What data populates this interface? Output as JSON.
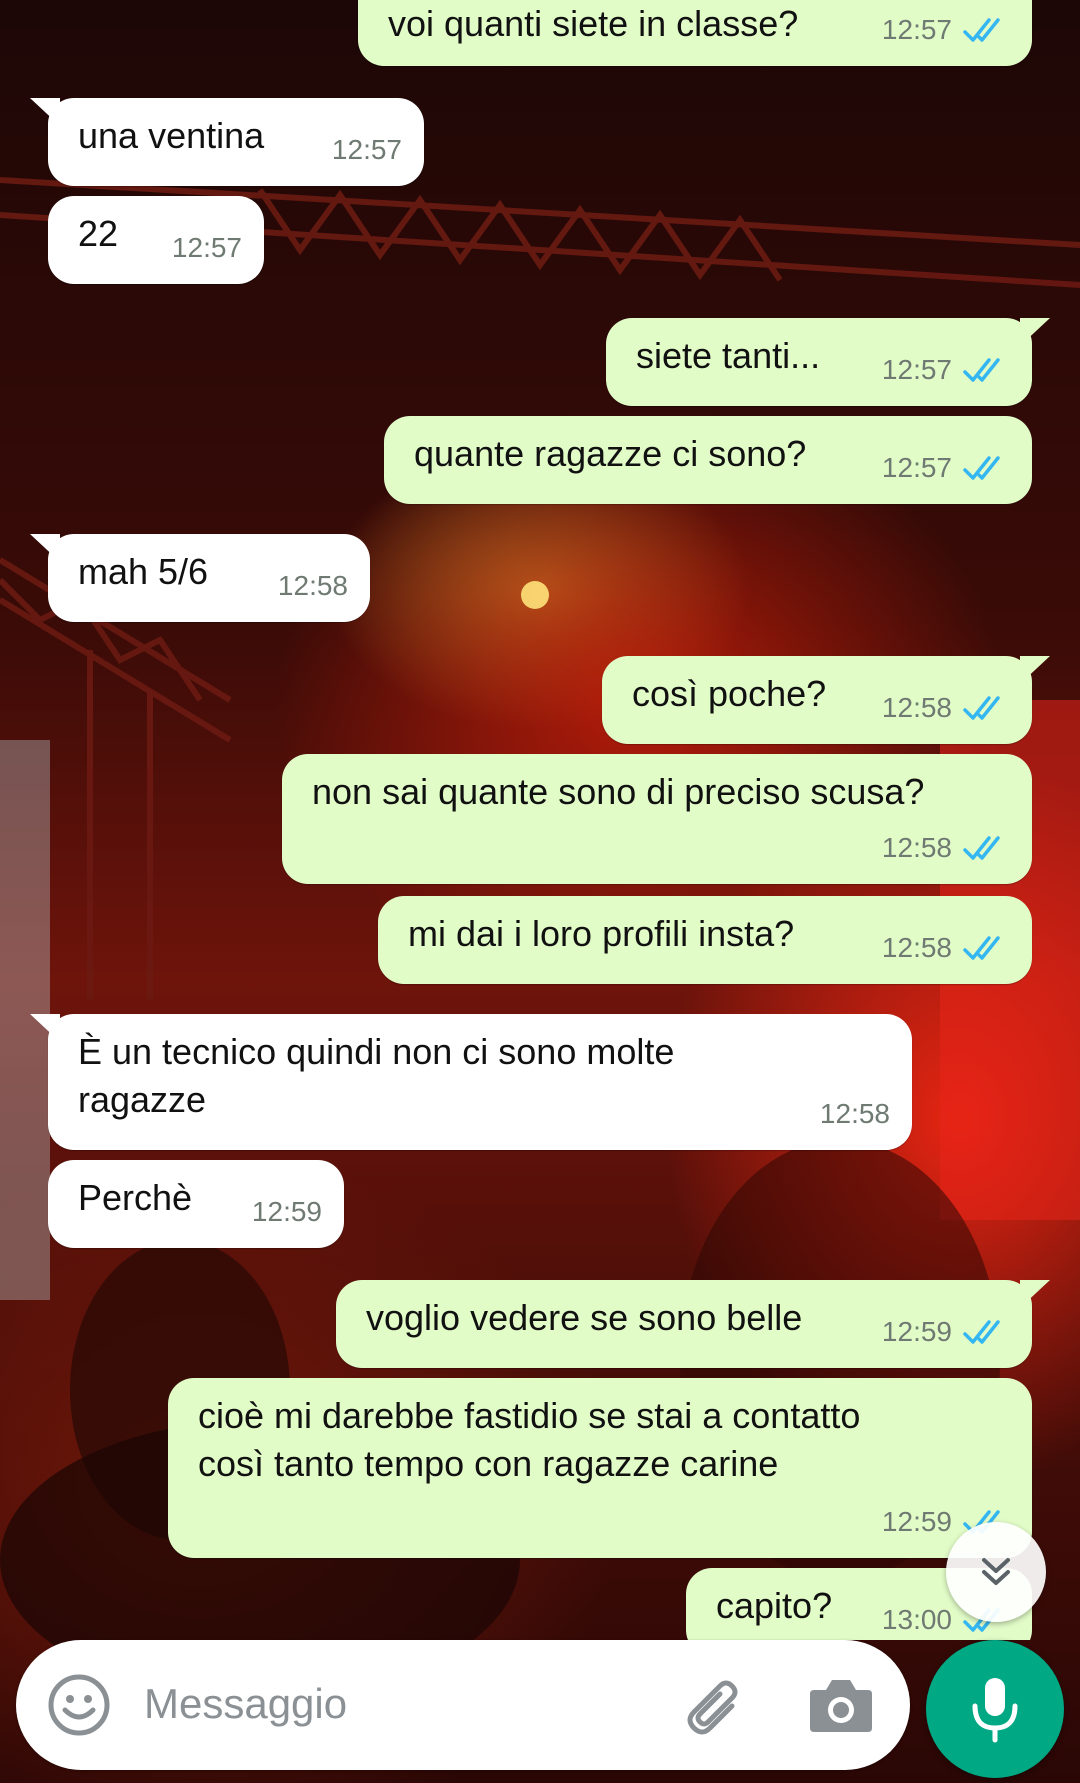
{
  "messages": [
    {
      "direction": "out",
      "text": "voi quanti siete in classe?",
      "time": "12:57",
      "status": "read"
    },
    {
      "direction": "in",
      "text": "una ventina",
      "time": "12:57"
    },
    {
      "direction": "in",
      "text": "22",
      "time": "12:57"
    },
    {
      "direction": "out",
      "text": "siete tanti...",
      "time": "12:57",
      "status": "read"
    },
    {
      "direction": "out",
      "text": "quante ragazze ci sono?",
      "time": "12:57",
      "status": "read"
    },
    {
      "direction": "in",
      "text": "mah 5/6",
      "time": "12:58"
    },
    {
      "direction": "out",
      "text": "così poche?",
      "time": "12:58",
      "status": "read"
    },
    {
      "direction": "out",
      "text": "non sai quante sono di preciso scusa?",
      "time": "12:58",
      "status": "read"
    },
    {
      "direction": "out",
      "text": "mi dai i loro profili insta?",
      "time": "12:58",
      "status": "read"
    },
    {
      "direction": "in",
      "lines": [
        "È un tecnico quindi non ci sono molte",
        "ragazze"
      ],
      "time": "12:58"
    },
    {
      "direction": "in",
      "text": "Perchè",
      "time": "12:59"
    },
    {
      "direction": "out",
      "text": "voglio vedere se sono belle",
      "time": "12:59",
      "status": "read"
    },
    {
      "direction": "out",
      "lines": [
        "cioè mi darebbe fastidio se stai a contatto",
        "così tanto tempo con ragazze carine"
      ],
      "time": "12:59",
      "status": "read"
    },
    {
      "direction": "out",
      "text": "capito?",
      "time": "13:00",
      "status": "read"
    }
  ],
  "composer": {
    "placeholder": "Messaggio",
    "emoji_icon": "emoji-icon",
    "attach_icon": "paperclip-icon",
    "camera_icon": "camera-icon",
    "send_icon": "microphone-icon"
  },
  "scroll_button": {
    "icon": "double-chevron-down-icon"
  },
  "colors": {
    "incoming_bubble": "#ffffff",
    "outgoing_bubble": "#e2fcc8",
    "read_ticks": "#34b7f1",
    "mic_button": "#01a884",
    "timestamp": "#6f7a72"
  }
}
